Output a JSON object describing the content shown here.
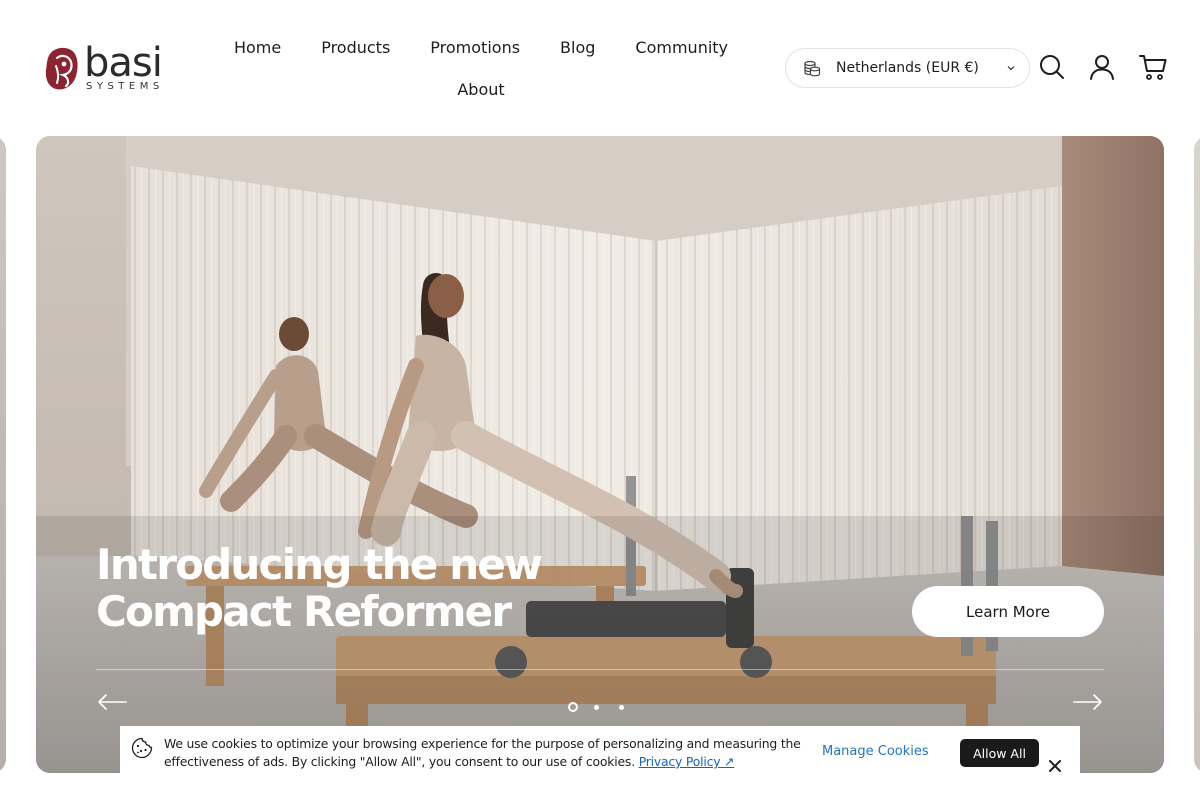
{
  "brand": {
    "name": "basi",
    "subtitle": "SYSTEMS",
    "accent_color": "#8b2330"
  },
  "nav": {
    "items": [
      {
        "label": "Home"
      },
      {
        "label": "Products"
      },
      {
        "label": "Promotions"
      },
      {
        "label": "Blog"
      },
      {
        "label": "Community"
      },
      {
        "label": "About"
      }
    ]
  },
  "header": {
    "country_selector": {
      "label": "Netherlands (EUR €)",
      "icon": "coins-icon"
    },
    "icons": [
      "search-icon",
      "account-icon",
      "cart-icon"
    ]
  },
  "hero": {
    "title_line1": "Introducing the new",
    "title_line2": "Compact Reformer",
    "cta_label": "Learn More",
    "slide_count": 3,
    "active_slide": 1
  },
  "cookie_banner": {
    "text": "We use cookies to optimize your browsing experience for the purpose of personalizing and measuring the effectiveness of ads. By clicking \"Allow All\", you consent to our use of cookies.",
    "privacy_link": "Privacy Policy ↗",
    "manage_label": "Manage Cookies",
    "allow_label": "Allow All"
  }
}
